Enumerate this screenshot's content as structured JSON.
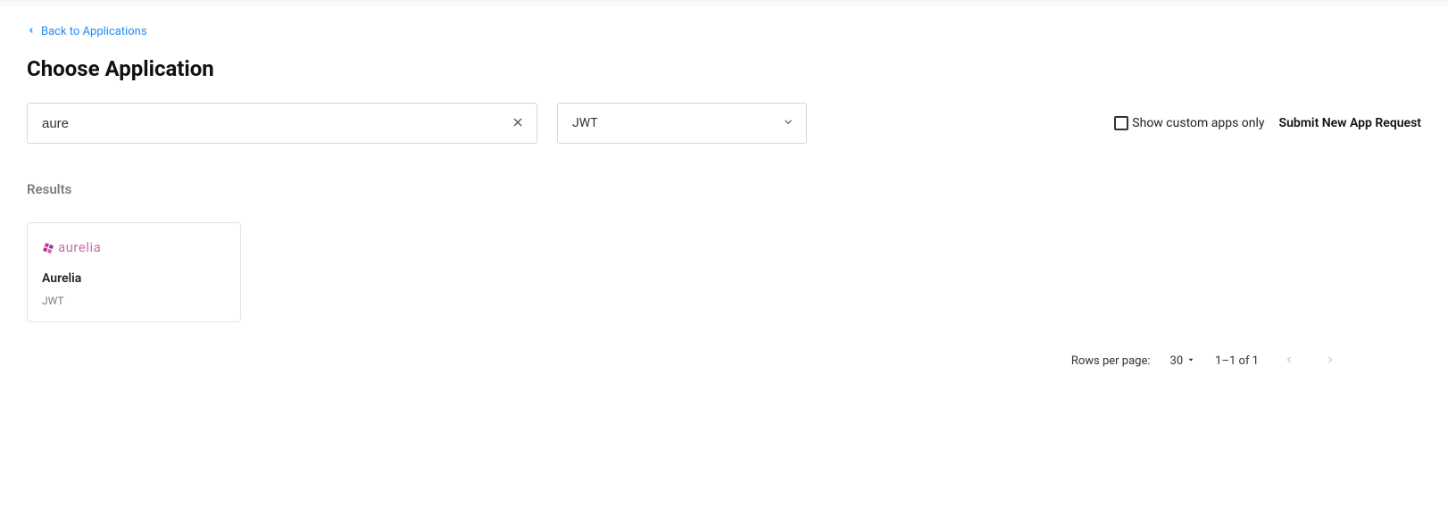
{
  "back_link": "Back to Applications",
  "page_title": "Choose Application",
  "search": {
    "value": "aure"
  },
  "filter_select": {
    "selected": "JWT"
  },
  "custom_apps_checkbox": {
    "label": "Show custom apps only",
    "checked": false
  },
  "submit_request_label": "Submit New App Request",
  "results_label": "Results",
  "result_card": {
    "logo_text": "aurelia",
    "title": "Aurelia",
    "subtitle": "JWT"
  },
  "pagination": {
    "rows_per_page_label": "Rows per page:",
    "rows_per_page_value": "30",
    "range_text": "1–1 of 1"
  }
}
